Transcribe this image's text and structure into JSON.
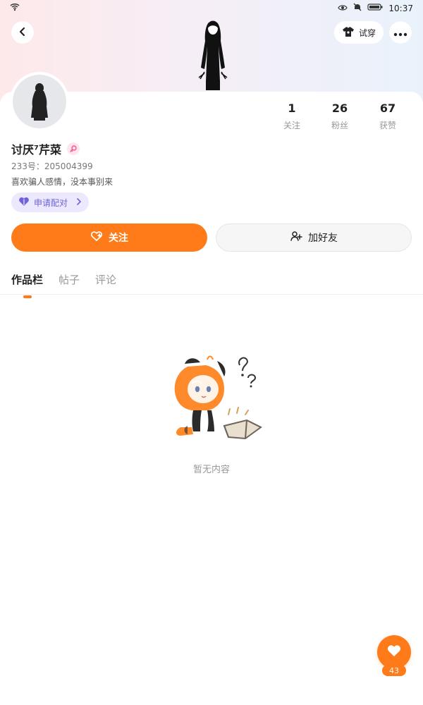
{
  "status_bar": {
    "time": "10:37",
    "icons": [
      "wifi-icon",
      "eye-icon",
      "mute-icon",
      "battery-icon"
    ]
  },
  "header": {
    "try_on_label": "试穿",
    "back_icon": "back-chevron-icon",
    "more_icon": "more-dots-icon",
    "character_figure": "character-figure-icon"
  },
  "profile": {
    "name": "讨厌⁷芹菜",
    "uid_text": "233号：205004399",
    "bio": "喜欢骗人感情，没本事别来",
    "gender_icon": "female-gender-icon"
  },
  "stats": [
    {
      "value": "1",
      "label": "关注"
    },
    {
      "value": "26",
      "label": "粉丝"
    },
    {
      "value": "67",
      "label": "获赞"
    }
  ],
  "pair": {
    "label": "申请配对",
    "icon": "heart-pair-icon"
  },
  "actions": {
    "follow_label": "关注",
    "add_friend_label": "加好友"
  },
  "tabs": [
    {
      "label": "作品栏",
      "active": true
    },
    {
      "label": "帖子",
      "active": false
    },
    {
      "label": "评论",
      "active": false
    }
  ],
  "empty_state": {
    "text": "暂无内容",
    "illustration": "empty-box-character-illustration"
  },
  "fab": {
    "count": "43",
    "icon": "heart-icon"
  },
  "colors": {
    "accent": "#ff7a18",
    "pair_bg": "#ece9ff",
    "pair_text": "#6f63d7"
  }
}
